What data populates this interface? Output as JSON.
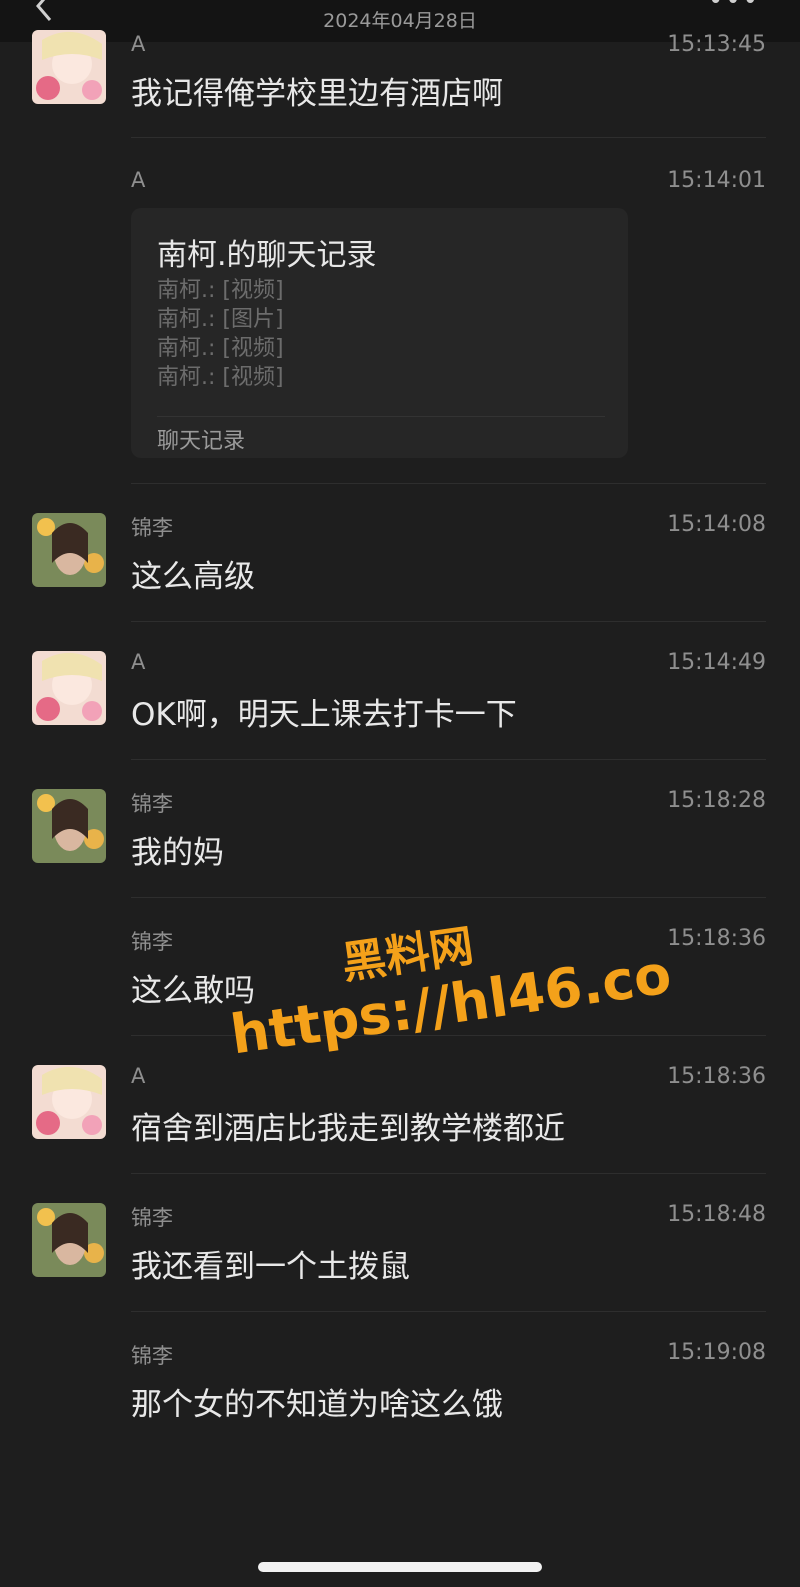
{
  "header": {
    "date": "2024年04月28日"
  },
  "messages": [
    {
      "sender": "A",
      "time": "15:13:45",
      "text": "我记得俺学校里边有酒店啊",
      "avatar": "anime-girl"
    },
    {
      "sender": "A",
      "time": "15:14:01",
      "type": "chat-record",
      "card": {
        "title": "南柯.的聊天记录",
        "lines": [
          "南柯.: [视频]",
          "南柯.: [图片]",
          "南柯.: [视频]",
          "南柯.: [视频]"
        ],
        "footer": "聊天记录"
      }
    },
    {
      "sender": "锦李",
      "time": "15:14:08",
      "text": "这么高级",
      "avatar": "photo-girl"
    },
    {
      "sender": "A",
      "time": "15:14:49",
      "text": "OK啊，明天上课去打卡一下",
      "avatar": "anime-girl"
    },
    {
      "sender": "锦李",
      "time": "15:18:28",
      "text": "我的妈",
      "avatar": "photo-girl"
    },
    {
      "sender": "锦李",
      "time": "15:18:36",
      "text": "这么敢吗"
    },
    {
      "sender": "A",
      "time": "15:18:36",
      "text": "宿舍到酒店比我走到教学楼都近",
      "avatar": "anime-girl"
    },
    {
      "sender": "锦李",
      "time": "15:18:48",
      "text": "我还看到一个土拨鼠",
      "avatar": "photo-girl"
    },
    {
      "sender": "锦李",
      "time": "15:19:08",
      "text": "那个女的不知道为啥这么饿"
    }
  ],
  "watermark": {
    "line1": "黑料网",
    "line2": "https://hl46.co",
    "color": "#f4a11a"
  },
  "colors": {
    "background": "#1e1e1e",
    "text": "#e8e8e8",
    "meta": "#8f8f8f"
  }
}
